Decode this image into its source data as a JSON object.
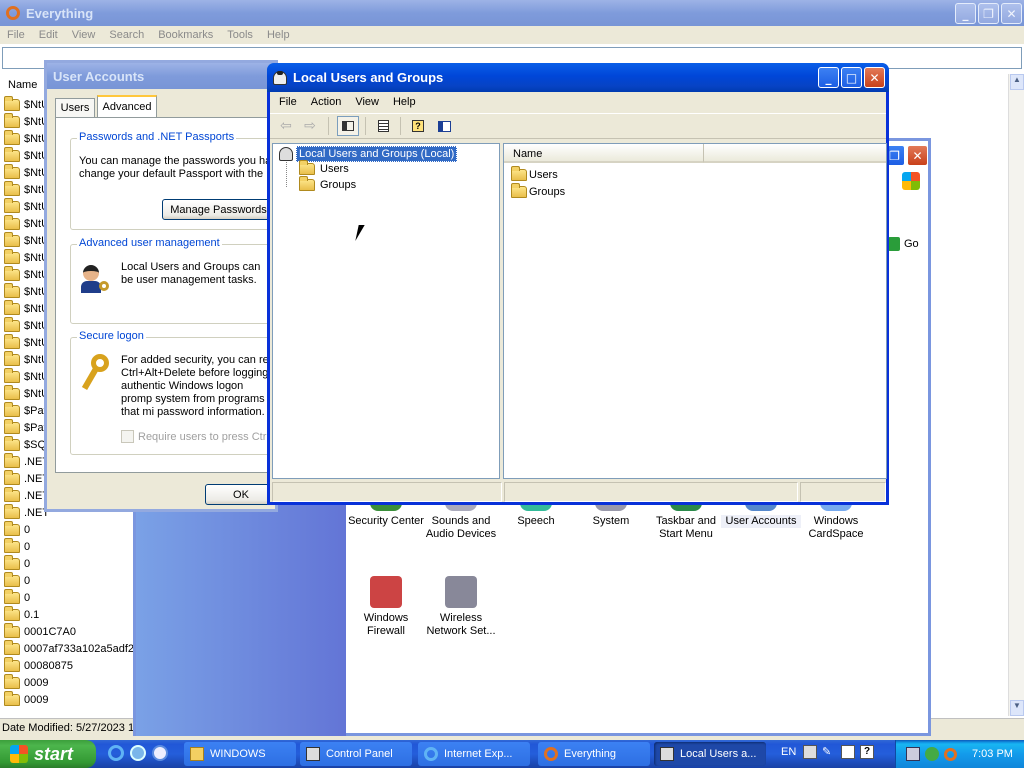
{
  "everything": {
    "title": "Everything",
    "menu": [
      "File",
      "Edit",
      "View",
      "Search",
      "Bookmarks",
      "Tools",
      "Help"
    ],
    "search_value": "",
    "column_name": "Name",
    "files": [
      "$NtU",
      "$NtU",
      "$NtU",
      "$NtU",
      "$NtU",
      "$NtU",
      "$NtU",
      "$NtU",
      "$NtU",
      "$NtU",
      "$NtU",
      "$NtU",
      "$NtU",
      "$NtU",
      "$NtU",
      "$NtU",
      "$NtU",
      "$NtU",
      "$Pat",
      "$Pat",
      "$SQL",
      ".NET",
      ".NET",
      ".NET",
      ".NET",
      "0",
      "0",
      "0",
      "0",
      "0",
      "0.1",
      "0001C7A0",
      "0007af733a102a5adf2",
      "00080875",
      "0009",
      "0009"
    ],
    "status": "Date Modified: 5/27/2023 1"
  },
  "control_panel": {
    "go_label": "Go",
    "icons": [
      {
        "label": "Security Center",
        "icon": "security-center-icon"
      },
      {
        "label": "Sounds and Audio Devices",
        "icon": "sounds-icon"
      },
      {
        "label": "Speech",
        "icon": "speech-icon"
      },
      {
        "label": "System",
        "icon": "system-icon"
      },
      {
        "label": "Taskbar and Start Menu",
        "icon": "taskbar-icon"
      },
      {
        "label": "User Accounts",
        "icon": "user-accounts-icon"
      },
      {
        "label": "Windows CardSpace",
        "icon": "cardspace-icon"
      },
      {
        "label": "Windows Firewall",
        "icon": "firewall-icon"
      },
      {
        "label": "Wireless Network Set...",
        "icon": "wireless-icon"
      }
    ]
  },
  "user_accounts": {
    "title": "User Accounts",
    "tabs": [
      "Users",
      "Advanced"
    ],
    "passports": {
      "heading": "Passwords and .NET Passports",
      "text": "You can manage the passwords you ha change your default Passport with the .",
      "button": "Manage Passwords"
    },
    "advanced": {
      "heading": "Advanced user management",
      "text": "Local Users and Groups can be user management tasks."
    },
    "secure": {
      "heading": "Secure logon",
      "text": "For added security, you can re Ctrl+Alt+Delete before logging authentic Windows logon promp system from programs that mi password information.",
      "checkbox": "Require users to press Ctrl+"
    },
    "ok": "OK"
  },
  "lusrmgr": {
    "title": "Local Users and Groups",
    "menu": [
      "File",
      "Action",
      "View",
      "Help"
    ],
    "tree_root": "Local Users and Groups (Local)",
    "tree_children": [
      "Users",
      "Groups"
    ],
    "list_header": "Name",
    "list_items": [
      "Users",
      "Groups"
    ]
  },
  "taskbar": {
    "start": "start",
    "tasks": [
      {
        "label": "WINDOWS",
        "icon": "folder-icon"
      },
      {
        "label": "Control Panel",
        "icon": "control-panel-icon"
      },
      {
        "label": "Internet Exp...",
        "icon": "ie-icon"
      },
      {
        "label": "Everything",
        "icon": "everything-icon"
      },
      {
        "label": "Local Users a...",
        "icon": "users-icon"
      }
    ],
    "lang": "EN",
    "clock": "7:03 PM"
  }
}
